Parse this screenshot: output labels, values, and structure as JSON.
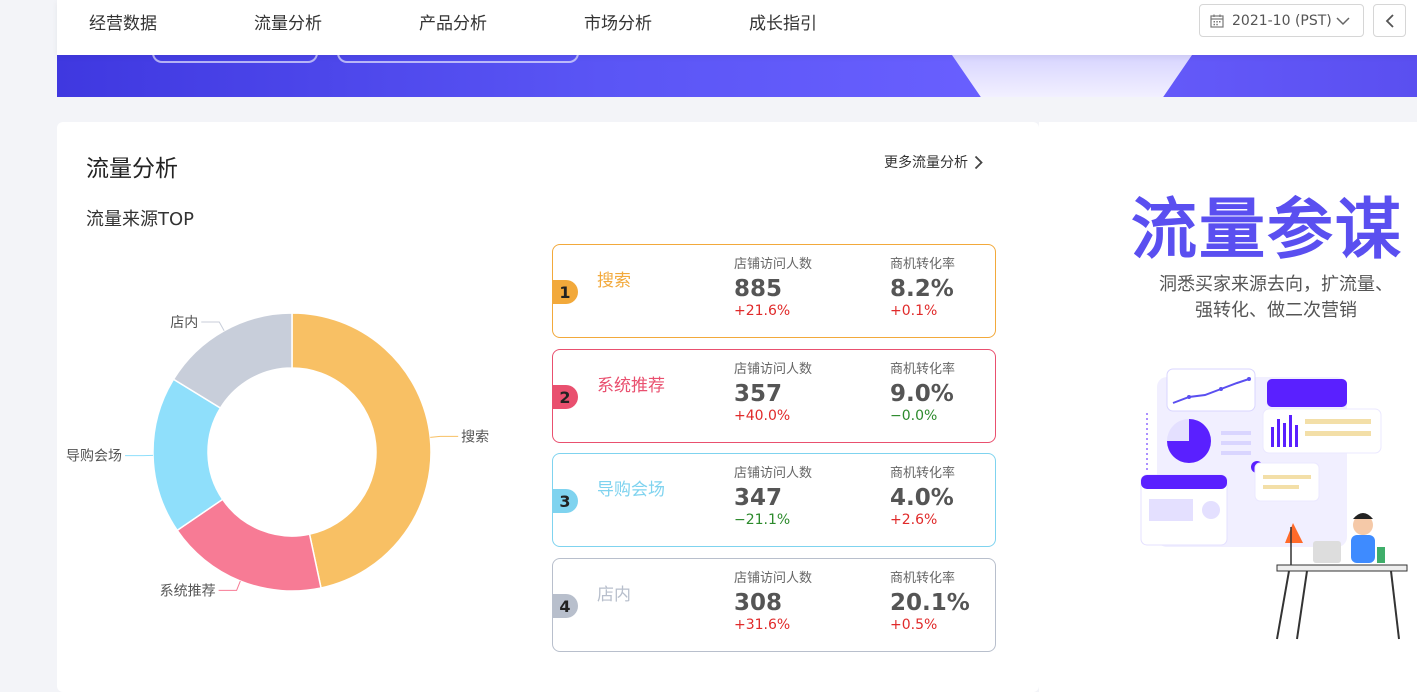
{
  "nav": {
    "items": [
      "经营数据",
      "流量分析",
      "产品分析",
      "市场分析",
      "成长指引"
    ],
    "date_value": "2021-10 (PST)"
  },
  "card": {
    "title": "流量分析",
    "more_link": "更多流量分析",
    "subtitle": "流量来源TOP"
  },
  "chart_data": {
    "type": "pie",
    "variant": "donut",
    "categories": [
      "搜索",
      "系统推荐",
      "导购会场",
      "店内"
    ],
    "values": [
      885,
      357,
      347,
      308
    ],
    "colors": [
      "#f8c064",
      "#f77b95",
      "#8fdffb",
      "#c8ceda"
    ]
  },
  "ranking": [
    {
      "rank": "1",
      "name": "搜索",
      "color": "#f2a93b",
      "visitors_label": "店铺访问人数",
      "visitors": "885",
      "visitors_change": "+21.6%",
      "visitors_dir": "up",
      "conv_label": "商机转化率",
      "conv": "8.2%",
      "conv_change": "+0.1%",
      "conv_dir": "up"
    },
    {
      "rank": "2",
      "name": "系统推荐",
      "color": "#e9506f",
      "visitors_label": "店铺访问人数",
      "visitors": "357",
      "visitors_change": "+40.0%",
      "visitors_dir": "up",
      "conv_label": "商机转化率",
      "conv": "9.0%",
      "conv_change": "−0.0%",
      "conv_dir": "down"
    },
    {
      "rank": "3",
      "name": "导购会场",
      "color": "#7fd3ef",
      "visitors_label": "店铺访问人数",
      "visitors": "347",
      "visitors_change": "−21.1%",
      "visitors_dir": "down",
      "conv_label": "商机转化率",
      "conv": "4.0%",
      "conv_change": "+2.6%",
      "conv_dir": "up"
    },
    {
      "rank": "4",
      "name": "店内",
      "color": "#b8bfcc",
      "visitors_label": "店铺访问人数",
      "visitors": "308",
      "visitors_change": "+31.6%",
      "visitors_dir": "up",
      "conv_label": "商机转化率",
      "conv": "20.1%",
      "conv_change": "+0.5%",
      "conv_dir": "up"
    }
  ],
  "promo": {
    "title": "流量参谋",
    "desc_line1": "洞悉买家来源去向，扩流量、",
    "desc_line2": "强转化、做二次营销"
  }
}
